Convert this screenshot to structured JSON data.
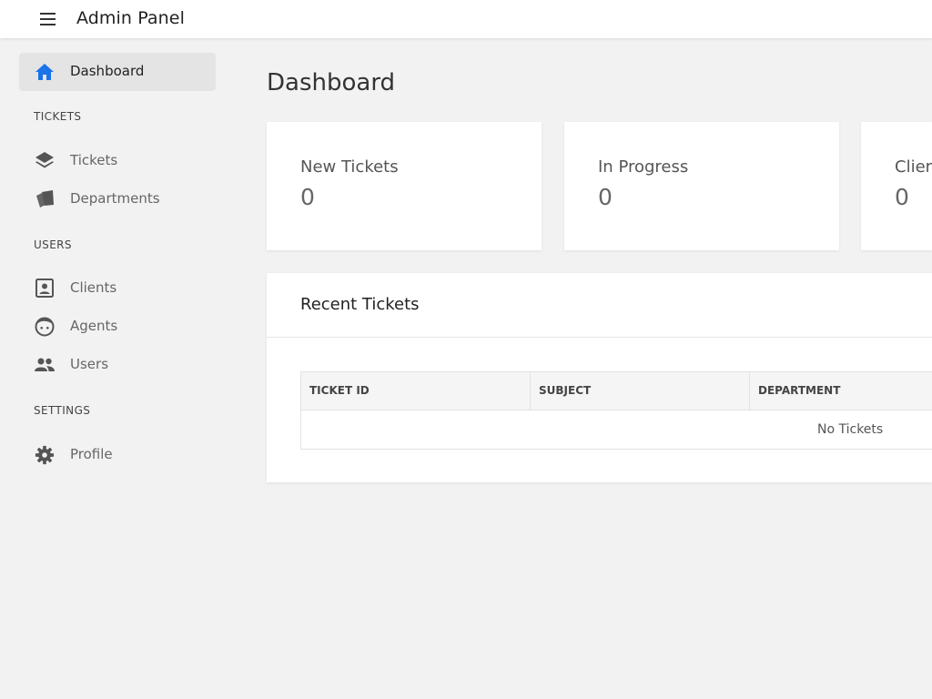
{
  "header": {
    "menu_icon": "hamburger-icon",
    "title": "Admin Panel"
  },
  "sidebar": {
    "dashboard": {
      "label": "Dashboard",
      "icon": "home-icon",
      "active": true,
      "accent": "#1a73e8"
    },
    "sections": [
      {
        "label": "TICKETS",
        "items": [
          {
            "label": "Tickets",
            "icon": "layers-icon"
          },
          {
            "label": "Departments",
            "icon": "cards-icon"
          }
        ]
      },
      {
        "label": "USERS",
        "items": [
          {
            "label": "Clients",
            "icon": "contact-card-icon"
          },
          {
            "label": "Agents",
            "icon": "face-icon"
          },
          {
            "label": "Users",
            "icon": "people-icon"
          }
        ]
      },
      {
        "label": "SETTINGS",
        "items": [
          {
            "label": "Profile",
            "icon": "gear-icon"
          }
        ]
      }
    ]
  },
  "main": {
    "title": "Dashboard",
    "stats": [
      {
        "title": "New Tickets",
        "value": "0"
      },
      {
        "title": "In Progress",
        "value": "0"
      },
      {
        "title": "Clier",
        "value": "0"
      }
    ],
    "recent": {
      "title": "Recent Tickets",
      "columns": [
        "TICKET ID",
        "SUBJECT",
        "DEPARTMENT"
      ],
      "empty_text": "No Tickets"
    }
  }
}
